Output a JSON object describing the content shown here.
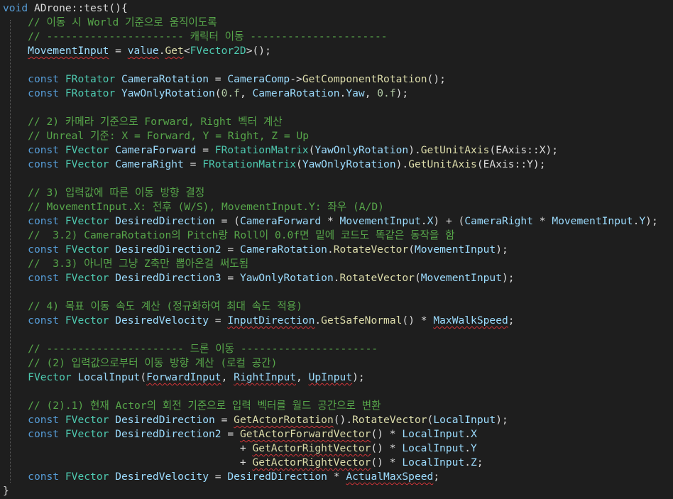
{
  "editor": {
    "colors": {
      "background": "#1e1e1e",
      "keyword": "#569cd6",
      "type": "#4ec9b0",
      "comment": "#57a64a",
      "variable": "#9cdcfe",
      "function": "#dcdcaa",
      "number": "#b5cea8",
      "plain": "#dcdcdc",
      "error_squiggle": "#d13438"
    },
    "lines": [
      {
        "tokens": [
          {
            "t": "void",
            "c": "kw"
          },
          {
            "t": " ADrone::test(){",
            "c": "pl"
          }
        ]
      },
      {
        "tokens": [
          {
            "t": "    // 이동 시 World 기준으로 움직이도록",
            "c": "cm"
          }
        ]
      },
      {
        "tokens": [
          {
            "t": "    // ---------------------- 캐릭터 이동 ----------------------",
            "c": "cm"
          }
        ]
      },
      {
        "tokens": [
          {
            "t": "    ",
            "c": "pl"
          },
          {
            "t": "MovementInput",
            "c": "var",
            "sq": true
          },
          {
            "t": " = ",
            "c": "pl"
          },
          {
            "t": "value",
            "c": "var",
            "sq": true
          },
          {
            "t": ".",
            "c": "pl"
          },
          {
            "t": "Get",
            "c": "fn",
            "sq": true
          },
          {
            "t": "<",
            "c": "pl"
          },
          {
            "t": "FVector2D",
            "c": "type"
          },
          {
            "t": ">();",
            "c": "pl"
          }
        ]
      },
      {
        "tokens": [
          {
            "t": "",
            "c": "pl"
          }
        ]
      },
      {
        "tokens": [
          {
            "t": "    ",
            "c": "pl"
          },
          {
            "t": "const",
            "c": "kw"
          },
          {
            "t": " ",
            "c": "pl"
          },
          {
            "t": "FRotator",
            "c": "type"
          },
          {
            "t": " ",
            "c": "pl"
          },
          {
            "t": "CameraRotation",
            "c": "var"
          },
          {
            "t": " = ",
            "c": "pl"
          },
          {
            "t": "CameraComp",
            "c": "var"
          },
          {
            "t": "->",
            "c": "pl"
          },
          {
            "t": "GetComponentRotation",
            "c": "fn"
          },
          {
            "t": "();",
            "c": "pl"
          }
        ]
      },
      {
        "tokens": [
          {
            "t": "    ",
            "c": "pl"
          },
          {
            "t": "const",
            "c": "kw"
          },
          {
            "t": " ",
            "c": "pl"
          },
          {
            "t": "FRotator",
            "c": "type"
          },
          {
            "t": " ",
            "c": "pl"
          },
          {
            "t": "YawOnlyRotation",
            "c": "var"
          },
          {
            "t": "(",
            "c": "pl"
          },
          {
            "t": "0.f",
            "c": "num"
          },
          {
            "t": ", ",
            "c": "pl"
          },
          {
            "t": "CameraRotation",
            "c": "var"
          },
          {
            "t": ".",
            "c": "pl"
          },
          {
            "t": "Yaw",
            "c": "var"
          },
          {
            "t": ", ",
            "c": "pl"
          },
          {
            "t": "0.f",
            "c": "num"
          },
          {
            "t": ");",
            "c": "pl"
          }
        ]
      },
      {
        "tokens": [
          {
            "t": "",
            "c": "pl"
          }
        ]
      },
      {
        "tokens": [
          {
            "t": "    // 2) 카메라 기준으로 Forward, Right 벡터 계산",
            "c": "cm"
          }
        ]
      },
      {
        "tokens": [
          {
            "t": "    // Unreal 기준: X = Forward, Y = Right, Z = Up",
            "c": "cm"
          }
        ]
      },
      {
        "tokens": [
          {
            "t": "    ",
            "c": "pl"
          },
          {
            "t": "const",
            "c": "kw"
          },
          {
            "t": " ",
            "c": "pl"
          },
          {
            "t": "FVector",
            "c": "type"
          },
          {
            "t": " ",
            "c": "pl"
          },
          {
            "t": "CameraForward",
            "c": "var"
          },
          {
            "t": " = ",
            "c": "pl"
          },
          {
            "t": "FRotationMatrix",
            "c": "type"
          },
          {
            "t": "(",
            "c": "pl"
          },
          {
            "t": "YawOnlyRotation",
            "c": "var"
          },
          {
            "t": ").",
            "c": "pl"
          },
          {
            "t": "GetUnitAxis",
            "c": "fn"
          },
          {
            "t": "(EAxis::X);",
            "c": "pl"
          }
        ]
      },
      {
        "tokens": [
          {
            "t": "    ",
            "c": "pl"
          },
          {
            "t": "const",
            "c": "kw"
          },
          {
            "t": " ",
            "c": "pl"
          },
          {
            "t": "FVector",
            "c": "type"
          },
          {
            "t": " ",
            "c": "pl"
          },
          {
            "t": "CameraRight",
            "c": "var"
          },
          {
            "t": " = ",
            "c": "pl"
          },
          {
            "t": "FRotationMatrix",
            "c": "type"
          },
          {
            "t": "(",
            "c": "pl"
          },
          {
            "t": "YawOnlyRotation",
            "c": "var"
          },
          {
            "t": ").",
            "c": "pl"
          },
          {
            "t": "GetUnitAxis",
            "c": "fn"
          },
          {
            "t": "(EAxis::Y);",
            "c": "pl"
          }
        ]
      },
      {
        "tokens": [
          {
            "t": "",
            "c": "pl"
          }
        ]
      },
      {
        "tokens": [
          {
            "t": "    // 3) 입력값에 따른 이동 방향 결정",
            "c": "cm"
          }
        ]
      },
      {
        "tokens": [
          {
            "t": "    // MovementInput.X: 전후 (W/S), MovementInput.Y: 좌우 (A/D)",
            "c": "cm"
          }
        ]
      },
      {
        "tokens": [
          {
            "t": "    ",
            "c": "pl"
          },
          {
            "t": "const",
            "c": "kw"
          },
          {
            "t": " ",
            "c": "pl"
          },
          {
            "t": "FVector",
            "c": "type"
          },
          {
            "t": " ",
            "c": "pl"
          },
          {
            "t": "DesiredDirection",
            "c": "var"
          },
          {
            "t": " = (",
            "c": "pl"
          },
          {
            "t": "CameraForward",
            "c": "var"
          },
          {
            "t": " * ",
            "c": "pl"
          },
          {
            "t": "MovementInput",
            "c": "var"
          },
          {
            "t": ".",
            "c": "pl"
          },
          {
            "t": "X",
            "c": "var"
          },
          {
            "t": ") + (",
            "c": "pl"
          },
          {
            "t": "CameraRight",
            "c": "var"
          },
          {
            "t": " * ",
            "c": "pl"
          },
          {
            "t": "MovementInput",
            "c": "var"
          },
          {
            "t": ".",
            "c": "pl"
          },
          {
            "t": "Y",
            "c": "var"
          },
          {
            "t": ");",
            "c": "pl"
          }
        ]
      },
      {
        "tokens": [
          {
            "t": "    //  3.2) CameraRotation의 Pitch랑 Roll이 0.0f면 밑에 코드도 똑같은 동작을 함",
            "c": "cm"
          }
        ]
      },
      {
        "tokens": [
          {
            "t": "    ",
            "c": "pl"
          },
          {
            "t": "const",
            "c": "kw"
          },
          {
            "t": " ",
            "c": "pl"
          },
          {
            "t": "FVector",
            "c": "type"
          },
          {
            "t": " ",
            "c": "pl"
          },
          {
            "t": "DesiredDirection2",
            "c": "var"
          },
          {
            "t": " = ",
            "c": "pl"
          },
          {
            "t": "CameraRotation",
            "c": "var"
          },
          {
            "t": ".",
            "c": "pl"
          },
          {
            "t": "RotateVector",
            "c": "fn"
          },
          {
            "t": "(",
            "c": "pl"
          },
          {
            "t": "MovementInput",
            "c": "var"
          },
          {
            "t": ");",
            "c": "pl"
          }
        ]
      },
      {
        "tokens": [
          {
            "t": "    //  3.3) 아니면 그냥 Z축만 뽑아온걸 써도됨",
            "c": "cm"
          }
        ]
      },
      {
        "tokens": [
          {
            "t": "    ",
            "c": "pl"
          },
          {
            "t": "const",
            "c": "kw"
          },
          {
            "t": " ",
            "c": "pl"
          },
          {
            "t": "FVector",
            "c": "type"
          },
          {
            "t": " ",
            "c": "pl"
          },
          {
            "t": "DesiredDirection3",
            "c": "var"
          },
          {
            "t": " = ",
            "c": "pl"
          },
          {
            "t": "YawOnlyRotation",
            "c": "var"
          },
          {
            "t": ".",
            "c": "pl"
          },
          {
            "t": "RotateVector",
            "c": "fn"
          },
          {
            "t": "(",
            "c": "pl"
          },
          {
            "t": "MovementInput",
            "c": "var"
          },
          {
            "t": ");",
            "c": "pl"
          }
        ]
      },
      {
        "tokens": [
          {
            "t": "",
            "c": "pl"
          }
        ]
      },
      {
        "tokens": [
          {
            "t": "    // 4) 목표 이동 속도 계산 (정규화하여 최대 속도 적용)",
            "c": "cm"
          }
        ]
      },
      {
        "tokens": [
          {
            "t": "    ",
            "c": "pl"
          },
          {
            "t": "const",
            "c": "kw"
          },
          {
            "t": " ",
            "c": "pl"
          },
          {
            "t": "FVector",
            "c": "type"
          },
          {
            "t": " ",
            "c": "pl"
          },
          {
            "t": "DesiredVelocity",
            "c": "var"
          },
          {
            "t": " = ",
            "c": "pl"
          },
          {
            "t": "InputDirection",
            "c": "var",
            "sq": true
          },
          {
            "t": ".",
            "c": "pl"
          },
          {
            "t": "GetSafeNormal",
            "c": "fn"
          },
          {
            "t": "() * ",
            "c": "pl"
          },
          {
            "t": "MaxWalkSpeed",
            "c": "var",
            "sq": true
          },
          {
            "t": ";",
            "c": "pl"
          }
        ]
      },
      {
        "tokens": [
          {
            "t": "",
            "c": "pl"
          }
        ]
      },
      {
        "tokens": [
          {
            "t": "    // ---------------------- 드론 이동 ----------------------",
            "c": "cm"
          }
        ]
      },
      {
        "tokens": [
          {
            "t": "    // (2) 입력값으로부터 이동 방향 계산 (로컬 공간)",
            "c": "cm"
          }
        ]
      },
      {
        "tokens": [
          {
            "t": "    ",
            "c": "pl"
          },
          {
            "t": "FVector",
            "c": "type"
          },
          {
            "t": " ",
            "c": "pl"
          },
          {
            "t": "LocalInput",
            "c": "var"
          },
          {
            "t": "(",
            "c": "pl"
          },
          {
            "t": "ForwardInput",
            "c": "var",
            "sq": true
          },
          {
            "t": ", ",
            "c": "pl"
          },
          {
            "t": "RightInput",
            "c": "var",
            "sq": true
          },
          {
            "t": ", ",
            "c": "pl"
          },
          {
            "t": "UpInput",
            "c": "var",
            "sq": true
          },
          {
            "t": ");",
            "c": "pl"
          }
        ]
      },
      {
        "tokens": [
          {
            "t": "",
            "c": "pl"
          }
        ]
      },
      {
        "tokens": [
          {
            "t": "    // (2).1) 현재 Actor의 회전 기준으로 입력 벡터를 월드 공간으로 변환",
            "c": "cm"
          }
        ]
      },
      {
        "tokens": [
          {
            "t": "    ",
            "c": "pl"
          },
          {
            "t": "const",
            "c": "kw"
          },
          {
            "t": " ",
            "c": "pl"
          },
          {
            "t": "FVector",
            "c": "type"
          },
          {
            "t": " ",
            "c": "pl"
          },
          {
            "t": "DesiredDirection",
            "c": "var"
          },
          {
            "t": " = ",
            "c": "pl"
          },
          {
            "t": "GetActorRotation",
            "c": "fn",
            "sq": true
          },
          {
            "t": "().",
            "c": "pl"
          },
          {
            "t": "RotateVector",
            "c": "fn"
          },
          {
            "t": "(",
            "c": "pl"
          },
          {
            "t": "LocalInput",
            "c": "var"
          },
          {
            "t": ");",
            "c": "pl"
          }
        ]
      },
      {
        "tokens": [
          {
            "t": "    ",
            "c": "pl"
          },
          {
            "t": "const",
            "c": "kw"
          },
          {
            "t": " ",
            "c": "pl"
          },
          {
            "t": "FVector",
            "c": "type"
          },
          {
            "t": " ",
            "c": "pl"
          },
          {
            "t": "DesiredDirection2",
            "c": "var"
          },
          {
            "t": " = ",
            "c": "pl"
          },
          {
            "t": "GetActorForwardVector",
            "c": "fn",
            "sq": true
          },
          {
            "t": "() * ",
            "c": "pl"
          },
          {
            "t": "LocalInput",
            "c": "var"
          },
          {
            "t": ".",
            "c": "pl"
          },
          {
            "t": "X",
            "c": "var"
          }
        ]
      },
      {
        "tokens": [
          {
            "t": "                                      + ",
            "c": "pl"
          },
          {
            "t": "GetActorRightVector",
            "c": "fn",
            "sq": true
          },
          {
            "t": "() * ",
            "c": "pl"
          },
          {
            "t": "LocalInput",
            "c": "var"
          },
          {
            "t": ".",
            "c": "pl"
          },
          {
            "t": "Y",
            "c": "var"
          }
        ]
      },
      {
        "tokens": [
          {
            "t": "                                      + ",
            "c": "pl"
          },
          {
            "t": "GetActorRightVector",
            "c": "fn",
            "sq": true
          },
          {
            "t": "() * ",
            "c": "pl"
          },
          {
            "t": "LocalInput",
            "c": "var"
          },
          {
            "t": ".",
            "c": "pl"
          },
          {
            "t": "Z",
            "c": "var"
          },
          {
            "t": ";",
            "c": "pl"
          }
        ]
      },
      {
        "tokens": [
          {
            "t": "    ",
            "c": "pl"
          },
          {
            "t": "const",
            "c": "kw"
          },
          {
            "t": " ",
            "c": "pl"
          },
          {
            "t": "FVector",
            "c": "type"
          },
          {
            "t": " ",
            "c": "pl"
          },
          {
            "t": "DesiredVelocity",
            "c": "var"
          },
          {
            "t": " = ",
            "c": "pl"
          },
          {
            "t": "DesiredDirection",
            "c": "var"
          },
          {
            "t": " * ",
            "c": "pl"
          },
          {
            "t": "ActualMaxSpeed",
            "c": "var",
            "sq": true
          },
          {
            "t": ";",
            "c": "pl"
          }
        ]
      },
      {
        "tokens": [
          {
            "t": "}",
            "c": "pl"
          }
        ]
      }
    ]
  }
}
